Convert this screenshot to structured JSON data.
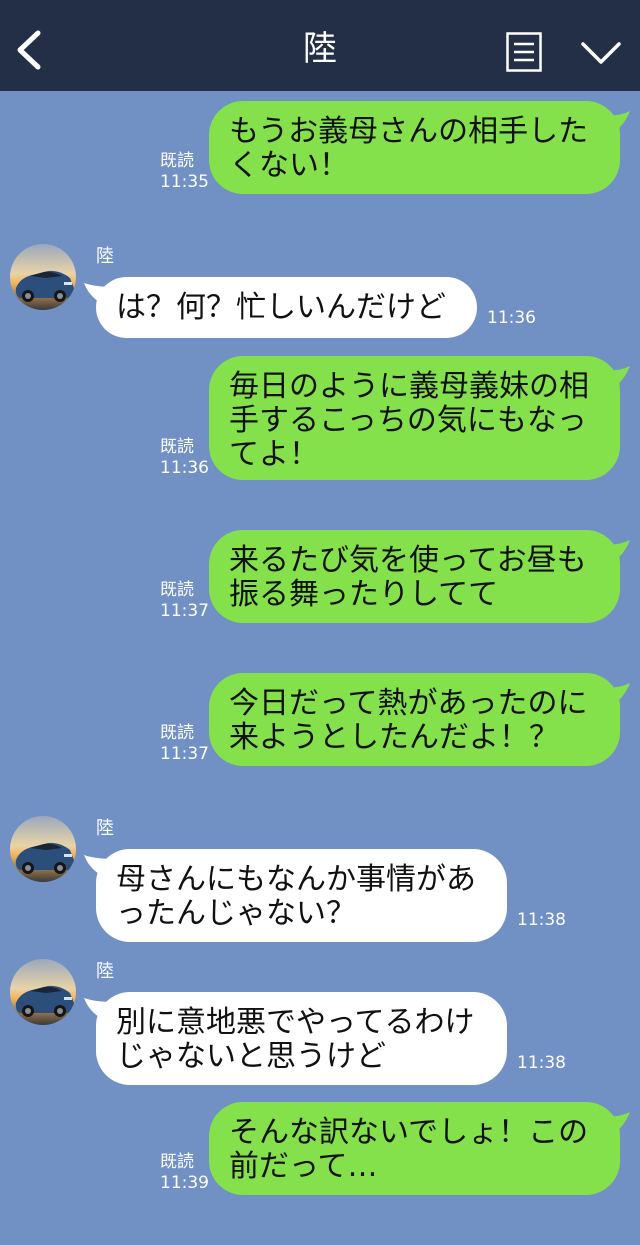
{
  "header": {
    "title": "陸",
    "back_icon": "chevron-left-icon",
    "menu_icon": "note-list-icon",
    "collapse_icon": "chevron-down-icon",
    "bar_color": "#232f46"
  },
  "colors": {
    "background": "#7190c4",
    "outgoing_bubble": "#85e14b",
    "incoming_bubble": "#ffffff"
  },
  "messages": [
    {
      "direction": "out",
      "lines": [
        "もうお義母さんの相手した",
        "くない！"
      ],
      "read": "既読",
      "time": "11:35"
    },
    {
      "direction": "in",
      "sender": "陸",
      "lines": [
        "は？何？忙しいんだけど"
      ],
      "time": "11:36"
    },
    {
      "direction": "out",
      "lines": [
        "毎日のように義母義妹の相",
        "手するこっちの気にもなっ",
        "てよ！"
      ],
      "read": "既読",
      "time": "11:36"
    },
    {
      "direction": "out",
      "lines": [
        "来るたび気を使ってお昼も",
        "振る舞ったりしてて"
      ],
      "read": "既読",
      "time": "11:37"
    },
    {
      "direction": "out",
      "lines": [
        "今日だって熱があったのに",
        "来ようとしたんだよ！？"
      ],
      "read": "既読",
      "time": "11:37"
    },
    {
      "direction": "in",
      "sender": "陸",
      "lines": [
        "母さんにもなんか事情があ",
        "ったんじゃない？"
      ],
      "time": "11:38"
    },
    {
      "direction": "in",
      "sender": "陸",
      "lines": [
        "別に意地悪でやってるわけ",
        "じゃないと思うけど"
      ],
      "time": "11:38"
    },
    {
      "direction": "out",
      "lines": [
        "そんな訳ないでしょ！この",
        "前だって…"
      ],
      "read": "既読",
      "time": "11:39"
    }
  ]
}
